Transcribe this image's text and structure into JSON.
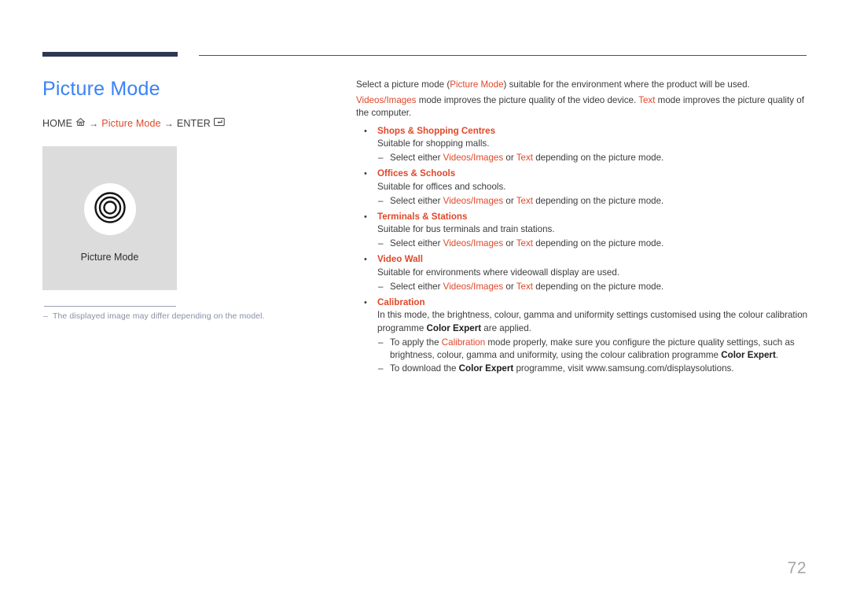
{
  "header": {
    "rule_accent_color": "#2e3754",
    "rule_line_color": "#4a4f68"
  },
  "page": {
    "title": "Picture Mode",
    "title_color": "#3b82f6",
    "number": "72",
    "accent_color": "#e0482a"
  },
  "breadcrumb": {
    "home_label": "HOME",
    "home_icon": "home-icon",
    "arrow_1": "→",
    "mode_label": "Picture Mode",
    "arrow_2": "→",
    "enter_label": "ENTER",
    "enter_icon": "enter-key-icon"
  },
  "figure": {
    "caption": "Picture Mode",
    "icon": "concentric-circles-icon",
    "background_color": "#dcdcdc",
    "note_dash": "–",
    "note": "The displayed image may differ depending on the model."
  },
  "main": {
    "intro": {
      "line1_a": "Select a picture mode (",
      "line1_accent": "Picture Mode",
      "line1_b": ") suitable for the environment where the product will be used.",
      "line2_accent1": "Videos/Images",
      "line2_a": " mode improves the picture quality of the video device. ",
      "line2_accent2": "Text",
      "line2_b": " mode improves the picture quality of the computer."
    },
    "bullet_marker": "•",
    "dash_marker": "–",
    "items": [
      {
        "heading": "Shops & Shopping Centres",
        "description": "Suitable for shopping malls.",
        "subitems": [
          {
            "a": "Select either ",
            "accent1": "Videos/Images",
            "b": " or ",
            "accent2": "Text",
            "c": " depending on the picture mode."
          }
        ]
      },
      {
        "heading": "Offices & Schools",
        "description": "Suitable for offices and schools.",
        "subitems": [
          {
            "a": "Select either ",
            "accent1": "Videos/Images",
            "b": " or ",
            "accent2": "Text",
            "c": " depending on the picture mode."
          }
        ]
      },
      {
        "heading": "Terminals & Stations",
        "description": "Suitable for bus terminals and train stations.",
        "subitems": [
          {
            "a": "Select either ",
            "accent1": "Videos/Images",
            "b": " or ",
            "accent2": "Text",
            "c": " depending on the picture mode."
          }
        ]
      },
      {
        "heading": "Video Wall",
        "description": "Suitable for environments where videowall display are used.",
        "subitems": [
          {
            "a": "Select either ",
            "accent1": "Videos/Images",
            "b": " or ",
            "accent2": "Text",
            "c": " depending on the picture mode."
          }
        ]
      }
    ],
    "calibration": {
      "heading": "Calibration",
      "desc_a": "In this mode, the brightness, colour, gamma and uniformity settings customised using the colour calibration programme ",
      "desc_bold": "Color Expert",
      "desc_b": " are applied.",
      "sub1_a": "To apply the ",
      "sub1_accent": "Calibration",
      "sub1_b": " mode properly, make sure you configure the picture quality settings, such as brightness, colour, gamma and uniformity, using the colour calibration programme ",
      "sub1_bold": "Color Expert",
      "sub1_c": ".",
      "sub2_a": "To download the ",
      "sub2_bold": "Color Expert",
      "sub2_b": " programme, visit www.samsung.com/displaysolutions."
    }
  }
}
